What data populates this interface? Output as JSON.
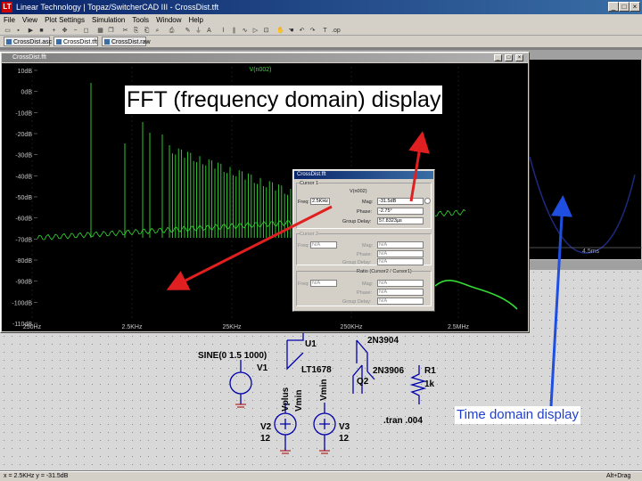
{
  "window": {
    "title": "Linear Technology | Topaz/SwitcherCAD III - CrossDist.tft",
    "icon": "LT"
  },
  "menu": [
    "File",
    "View",
    "Plot Settings",
    "Simulation",
    "Tools",
    "Window",
    "Help"
  ],
  "tabs": [
    {
      "label": "CrossDist.asc",
      "active": false
    },
    {
      "label": "CrossDist.tft",
      "active": true
    },
    {
      "label": "CrossDist.raw",
      "active": false
    }
  ],
  "fft_window": {
    "title": "CrossDist.fft",
    "trace_label": "V(n002)",
    "y_ticks": [
      "10dB",
      "0dB",
      "-10dB",
      "-20dB",
      "-30dB",
      "-40dB",
      "-50dB",
      "-60dB",
      "-70dB",
      "-80dB",
      "-90dB",
      "-100dB",
      "-110dB"
    ],
    "x_ticks": [
      "250Hz",
      "2.5KHz",
      "25KHz",
      "250KHz",
      "2.5MHz"
    ],
    "trace_color": "#33dd33"
  },
  "wave_window": {
    "axis_label": "4.5ms",
    "trace_color": "#1c2a80"
  },
  "cursor_dialog": {
    "title": "CrossDist.fft",
    "cursor1": {
      "group": "Cursor 1",
      "trace": "V(n002)",
      "freq_label": "Freq:",
      "freq_value": "2.5KHz",
      "mag_label": "Mag:",
      "mag_value": "-31.5dB",
      "phase_label": "Phase:",
      "phase_value": "-2.75°",
      "gd_label": "Group Delay:",
      "gd_value": "57.8323µs"
    },
    "cursor2": {
      "group": "Cursor 2",
      "freq_label": "Freq:",
      "freq_value": "N/A",
      "mag_label": "Mag:",
      "mag_value": "N/A",
      "phase_label": "Phase:",
      "phase_value": "N/A",
      "gd_label": "Group Delay:",
      "gd_value": "N/A"
    },
    "ratio": {
      "group": "Ratio (Cursor2 / Cursor1)",
      "freq_label": "Freq:",
      "freq_value": "N/A",
      "mag_label": "Mag:",
      "mag_value": "N/A",
      "phase_label": "Phase:",
      "phase_value": "N/A",
      "gd_label": "Group Delay:",
      "gd_value": "N/A"
    }
  },
  "schematic": {
    "u1": "U1",
    "u1_part": "LT1678",
    "sine": "SINE(0 1.5 1000)",
    "v1": "V1",
    "v2": "V2",
    "v2_val": "12",
    "v3": "V3",
    "v3_val": "12",
    "q1_part": "2N3904",
    "q2": "Q2",
    "q2_part": "2N3906",
    "r1": "R1",
    "r1_val": "1k",
    "vplus": "Vplus",
    "vmin1": "Vmin",
    "vmin2": "Vmin",
    "directive": ".tran .004"
  },
  "statusbar": {
    "left": "x = 2.5KHz   y = -31.5dB",
    "right": "Alt+Drag"
  },
  "annotations": {
    "fft_caption": "FFT (frequency domain) display",
    "time_caption": "Time domain display",
    "red_arrow_color": "#e02020",
    "blue_arrow_color": "#1f4fe0"
  }
}
